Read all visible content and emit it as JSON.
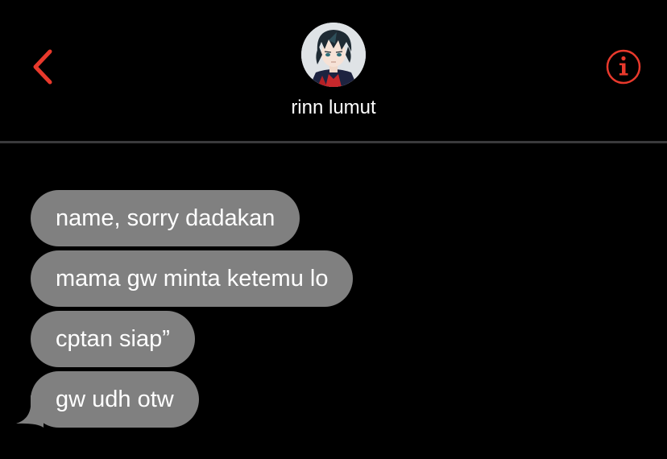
{
  "header": {
    "contact_name": "rinn lumut",
    "back_icon": "chevron-left-icon",
    "info_icon": "info-circle-icon",
    "accent_color": "#e8392c"
  },
  "messages": [
    {
      "text": "name, sorry dadakan"
    },
    {
      "text": "mama gw minta ketemu lo"
    },
    {
      "text": "cptan siap”"
    },
    {
      "text": "gw udh otw"
    }
  ],
  "colors": {
    "background": "#000000",
    "bubble_incoming": "#808080",
    "divider": "#3a3a3c"
  }
}
